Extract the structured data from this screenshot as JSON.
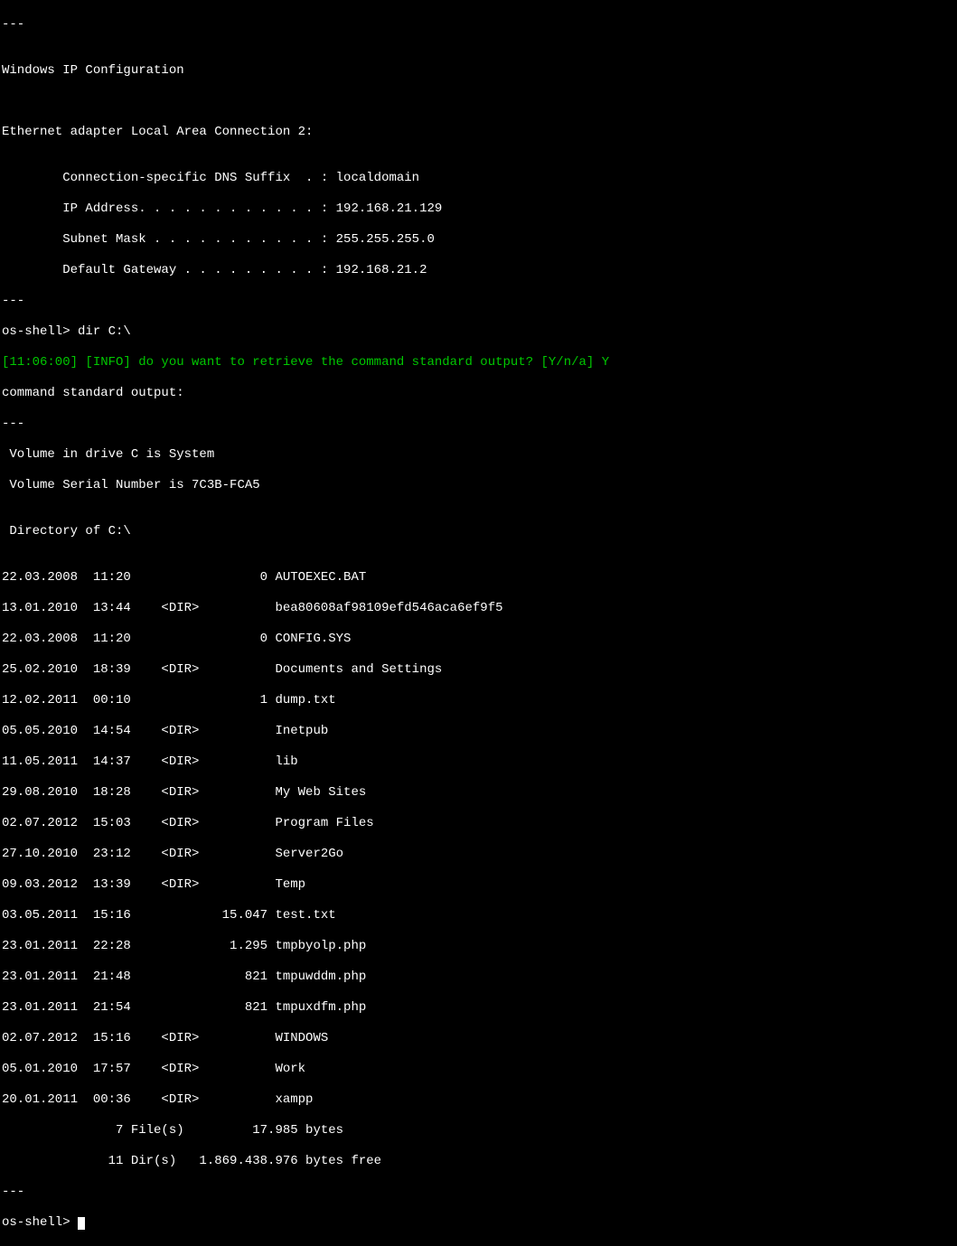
{
  "lines": {
    "sep1": "---",
    "blank1": "",
    "ipconfig_title": "Windows IP Configuration",
    "blank2": "",
    "blank3": "",
    "adapter_header": "Ethernet adapter Local Area Connection 2:",
    "blank4": "",
    "dns_suffix": "        Connection-specific DNS Suffix  . : localdomain",
    "ip_address": "        IP Address. . . . . . . . . . . . : 192.168.21.129",
    "subnet_mask": "        Subnet Mask . . . . . . . . . . . : 255.255.255.0",
    "default_gateway": "        Default Gateway . . . . . . . . . : 192.168.21.2",
    "sep2": "---",
    "prompt1": "os-shell> dir C:\\",
    "info_line": "[11:06:00] [INFO] do you want to retrieve the command standard output? [Y/n/a] Y",
    "std_output": "command standard output:",
    "sep3": "---",
    "volume_line": " Volume in drive C is System",
    "serial_line": " Volume Serial Number is 7C3B-FCA5",
    "blank5": "",
    "dir_of": " Directory of C:\\",
    "blank6": "",
    "d1": "22.03.2008  11:20                 0 AUTOEXEC.BAT",
    "d2": "13.01.2010  13:44    <DIR>          bea80608af98109efd546aca6ef9f5",
    "d3": "22.03.2008  11:20                 0 CONFIG.SYS",
    "d4": "25.02.2010  18:39    <DIR>          Documents and Settings",
    "d5": "12.02.2011  00:10                 1 dump.txt",
    "d6": "05.05.2010  14:54    <DIR>          Inetpub",
    "d7": "11.05.2011  14:37    <DIR>          lib",
    "d8": "29.08.2010  18:28    <DIR>          My Web Sites",
    "d9": "02.07.2012  15:03    <DIR>          Program Files",
    "d10": "27.10.2010  23:12    <DIR>          Server2Go",
    "d11": "09.03.2012  13:39    <DIR>          Temp",
    "d12": "03.05.2011  15:16            15.047 test.txt",
    "d13": "23.01.2011  22:28             1.295 tmpbyolp.php",
    "d14": "23.01.2011  21:48               821 tmpuwddm.php",
    "d15": "23.01.2011  21:54               821 tmpuxdfm.php",
    "d16": "02.07.2012  15:16    <DIR>          WINDOWS",
    "d17": "05.01.2010  17:57    <DIR>          Work",
    "d18": "20.01.2011  00:36    <DIR>          xampp",
    "summary_files": "               7 File(s)         17.985 bytes",
    "summary_dirs": "              11 Dir(s)   1.869.438.976 bytes free",
    "sep4": "---",
    "prompt2": "os-shell> "
  }
}
